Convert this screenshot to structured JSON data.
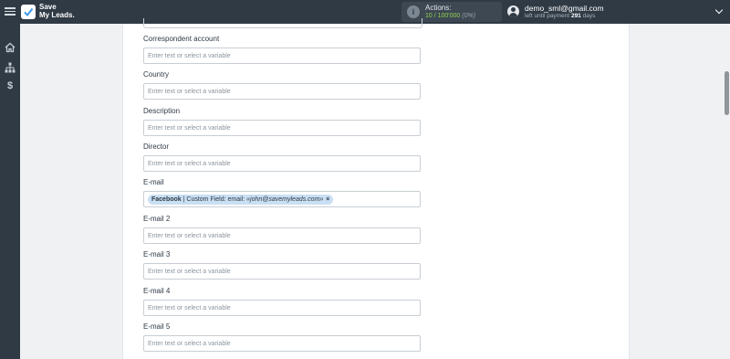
{
  "header": {
    "logo_line1": "Save",
    "logo_line2": "My Leads.",
    "actions_label": "Actions:",
    "actions_count": "10 / 100'000",
    "actions_percent": "(0%)",
    "user_email": "demo_sml@gmail.com",
    "payment_prefix": "left until payment",
    "payment_days": "291",
    "payment_suffix": "days"
  },
  "colors": {
    "topbar": "#2f3a45",
    "accent_green": "#8fd14f",
    "tag_bg": "#c9dff3"
  },
  "icons": [
    "menu-icon",
    "logo-check-icon",
    "info-icon",
    "user-icon",
    "chevron-down-icon",
    "home-icon",
    "sitemap-icon",
    "dollar-icon"
  ],
  "fields": [
    {
      "label": "Correspondent account",
      "placeholder": "Enter text or select a variable"
    },
    {
      "label": "Country",
      "placeholder": "Enter text or select a variable"
    },
    {
      "label": "Description",
      "placeholder": "Enter text or select a variable"
    },
    {
      "label": "Director",
      "placeholder": "Enter text or select a variable"
    },
    {
      "label": "E-mail",
      "tag": {
        "source": "Facebook",
        "text": " | Custom Field: email: ",
        "value": "«john@savemyleads.com»",
        "remove": "×"
      }
    },
    {
      "label": "E-mail 2",
      "placeholder": "Enter text or select a variable"
    },
    {
      "label": "E-mail 3",
      "placeholder": "Enter text or select a variable"
    },
    {
      "label": "E-mail 4",
      "placeholder": "Enter text or select a variable"
    },
    {
      "label": "E-mail 5",
      "placeholder": "Enter text or select a variable"
    }
  ]
}
